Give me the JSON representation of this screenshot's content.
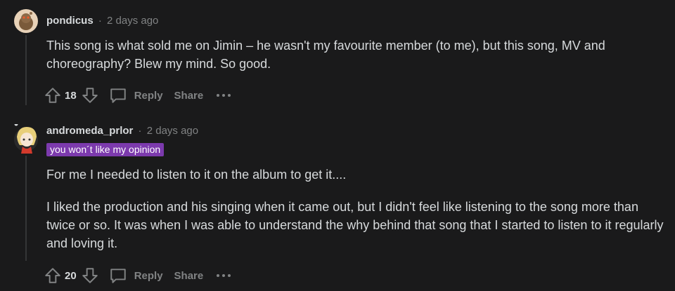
{
  "colors": {
    "background": "#1a1a1b",
    "text": "#d7dadc",
    "muted": "#818384",
    "flair_bg": "#7c3aad"
  },
  "comments": [
    {
      "username": "pondicus",
      "separator": "·",
      "time": "2 days ago",
      "flair": null,
      "paragraphs": [
        "This song is what sold me on Jimin – he wasn't my favourite member (to me), but this song, MV and choreography? Blew my mind. So good."
      ],
      "votes": "18",
      "reply_label": "Reply",
      "share_label": "Share",
      "avatar_icon": "snoo-avatar-icon"
    },
    {
      "username": "andromeda_prlor",
      "separator": "·",
      "time": "2 days ago",
      "flair": "you won´t like my opinion",
      "paragraphs": [
        "For me I needed to listen to it on the album to get it....",
        "I liked the production and his singing when it came out, but I didn't feel like listening to the song more than twice or so. It was when I was able to understand the why behind that song that I started to listen to it regularly and loving it."
      ],
      "votes": "20",
      "reply_label": "Reply",
      "share_label": "Share",
      "avatar_icon": "anime-avatar-icon"
    }
  ]
}
